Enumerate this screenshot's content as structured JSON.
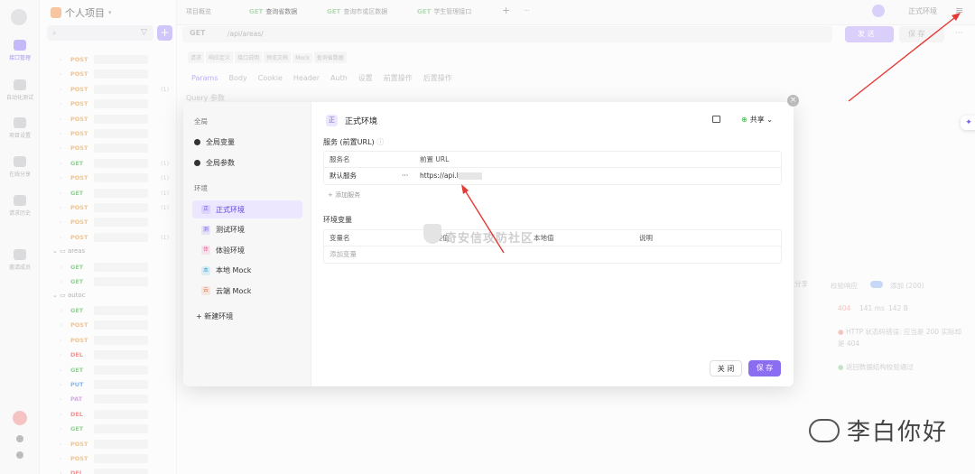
{
  "sidebar": {
    "items": [
      {
        "label": "接口管理",
        "active": true
      },
      {
        "label": "自动化测试"
      },
      {
        "label": "项目设置"
      },
      {
        "label": "在线分享"
      },
      {
        "label": "请求历史"
      },
      {
        "label": "邀请成员"
      }
    ]
  },
  "project": {
    "title": "个人项目",
    "search_placeholder": "",
    "methods": [
      "POST",
      "POST",
      "POST",
      "POST",
      "POST",
      "POST",
      "POST",
      "GET",
      "POST",
      "GET",
      "POST",
      "POST",
      "POST"
    ],
    "counts": [
      "(1)",
      "(1)",
      "(1)",
      "(1)",
      "(1)",
      "(1)"
    ],
    "folders": [
      "areas",
      "autoc"
    ],
    "methods2": [
      "GET",
      "GET"
    ],
    "methods3": [
      "GET",
      "POST",
      "POST",
      "DEL",
      "GET",
      "PUT",
      "PAT",
      "DEL",
      "GET",
      "POST",
      "POST",
      "DEL"
    ]
  },
  "tabs": [
    {
      "method": "",
      "label": "项目概览"
    },
    {
      "method": "GET",
      "label": "查询省数据",
      "active": true
    },
    {
      "method": "GET",
      "label": "查询市或区数据"
    },
    {
      "method": "GET",
      "label": "学生管理接口"
    }
  ],
  "tab_plus": "+",
  "tab_more": "···",
  "env_selector": "正式环境",
  "menu_icon": "≡",
  "request": {
    "method": "GET",
    "path": "/api/areas/",
    "send_label": "发 送",
    "save_label": "保 存",
    "more": "···"
  },
  "subtabs": [
    "请求",
    "响应定义",
    "接口说明",
    "预览文档",
    "Mock",
    "查询省数据"
  ],
  "param_tabs": [
    "Params",
    "Body",
    "Cookie",
    "Header",
    "Auth",
    "设置",
    "前置操作",
    "后置操作"
  ],
  "query_label": "Query 参数",
  "response": {
    "check_label": "校验响应",
    "toggle_label": "添加 (200)",
    "status": "404",
    "time": "141 ms",
    "size": "142 B",
    "error_line": "HTTP 状态码错误: 应当是 200 实际却是 404",
    "ok_line": "返回数据结构校验通过",
    "share": "分享"
  },
  "modal": {
    "global_section": "全局",
    "global_vars": "全局变量",
    "global_params": "全局参数",
    "env_section": "环境",
    "environments": [
      {
        "icon": "正",
        "label": "正式环境",
        "color": "#7b5cf0",
        "active": true
      },
      {
        "icon": "测",
        "label": "测试环境",
        "color": "#7b5cf0"
      },
      {
        "icon": "体",
        "label": "体验环境",
        "color": "#e86a9a"
      },
      {
        "icon": "本",
        "label": "本地 Mock",
        "color": "#3aa8d8"
      },
      {
        "icon": "云",
        "label": "云端 Mock",
        "color": "#e87a4a"
      }
    ],
    "new_env": "+ 新建环境",
    "title_icon": "正",
    "title": "正式环境",
    "share": "共享",
    "service_label": "服务 (前置URL)",
    "service_cols": [
      "服务名",
      "前置 URL"
    ],
    "service_rows": [
      {
        "name": "默认服务",
        "more": "···",
        "url": "https://api.l"
      }
    ],
    "add_service": "+ 添加服务",
    "envvar_label": "环境变量",
    "envvar_cols": [
      "变量名",
      "远程值",
      "本地值",
      "说明"
    ],
    "add_var": "添加变量",
    "watermark": "奇安信攻防社区",
    "close_btn": "关 闭",
    "save_btn": "保 存",
    "close_x": "×"
  },
  "ai_button": "✦",
  "brand": "李白你好"
}
